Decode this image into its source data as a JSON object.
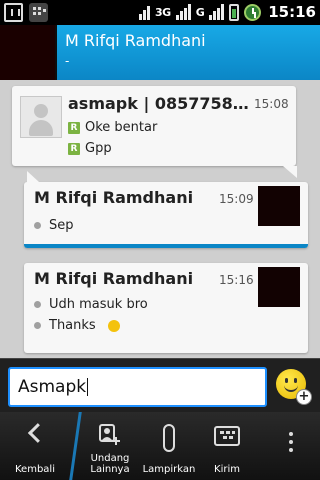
{
  "statusbar": {
    "network_3g": "3G",
    "network_g": "G",
    "time": "15:16"
  },
  "header": {
    "title": "M Rifqi Ramdhani",
    "subtitle": "-"
  },
  "messages": [
    {
      "sender": "asmapk | 0857758978...",
      "time": "15:08",
      "direction": "incoming",
      "lines": [
        "Oke bentar",
        "Gpp"
      ],
      "status_icon": "R"
    },
    {
      "sender": "M Rifqi Ramdhani",
      "time": "15:09",
      "direction": "outgoing",
      "lines": [
        "Sep"
      ]
    },
    {
      "sender": "M Rifqi Ramdhani",
      "time": "15:16",
      "direction": "outgoing",
      "lines": [
        "Udh masuk bro",
        "Thanks"
      ],
      "emoticon_after_last_line": "smiley-icon"
    }
  ],
  "input": {
    "value": "Asmapk"
  },
  "toolbar": {
    "back_label": "Kembali",
    "invite_label_1": "Undang",
    "invite_label_2": "Lainnya",
    "attach_label": "Lampirkan",
    "send_label": "Kirim"
  },
  "colors": {
    "accent_blue": "#0b86c6",
    "chat_background": "#cfcfcf",
    "read_icon_green": "#7cb342"
  }
}
